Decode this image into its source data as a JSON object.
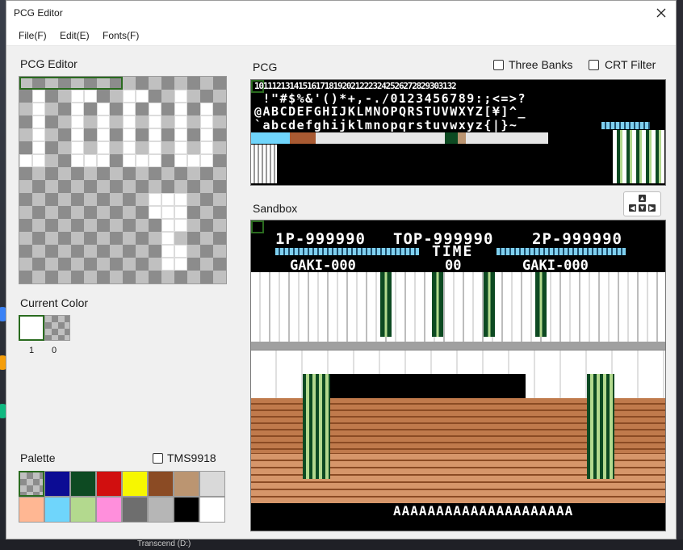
{
  "window": {
    "title": "PCG Editor",
    "close_icon": "close-icon"
  },
  "menu": {
    "file": "File(F)",
    "edit": "Edit(E)",
    "fonts": "Fonts(F)"
  },
  "editor": {
    "heading": "PCG Editor"
  },
  "current_color": {
    "heading": "Current Color",
    "fg_index": "1",
    "bg_index": "0",
    "fg_color": "#ffffff"
  },
  "palette": {
    "heading": "Palette",
    "tms_label": "TMS9918",
    "colors": [
      "#transparent",
      "#0c0c94",
      "#0d4a22",
      "#d10f0f",
      "#f7f700",
      "#8b4b24",
      "#bb9571",
      "#d9d9d9",
      "#ffb793",
      "#6fd5fb",
      "#b3d98e",
      "#ff8fdc",
      "#6e6e6e",
      "#b6b6b6",
      "#000000",
      "#ffffff"
    ]
  },
  "pcg": {
    "heading": "PCG",
    "three_banks": "Three Banks",
    "crt_filter": "CRT Filter",
    "row1": "1011121314151617181920212223242526272829303132",
    "row2": " !\"#$%&'()*+,-./0123456789:;<=>?",
    "row3": "@ABCDEFGHIJKLMNOPQRSTUVWXYZ[¥]^_",
    "row4": "`abcdefghijklmnopqrstuvwxyz{|}~"
  },
  "sandbox": {
    "heading": "Sandbox",
    "p1_score": "1P-999990",
    "top_score": "TOP-999990",
    "p2_score": "2P-999990",
    "time_label": "TIME",
    "time_value": "00",
    "gaki_left": "GAKI-000",
    "gaki_right": "GAKI-000",
    "bottom_text": "AAAAAAAAAAAAAAAAAAAAA"
  },
  "taskbar": {
    "item": "Transcend (D:)"
  }
}
